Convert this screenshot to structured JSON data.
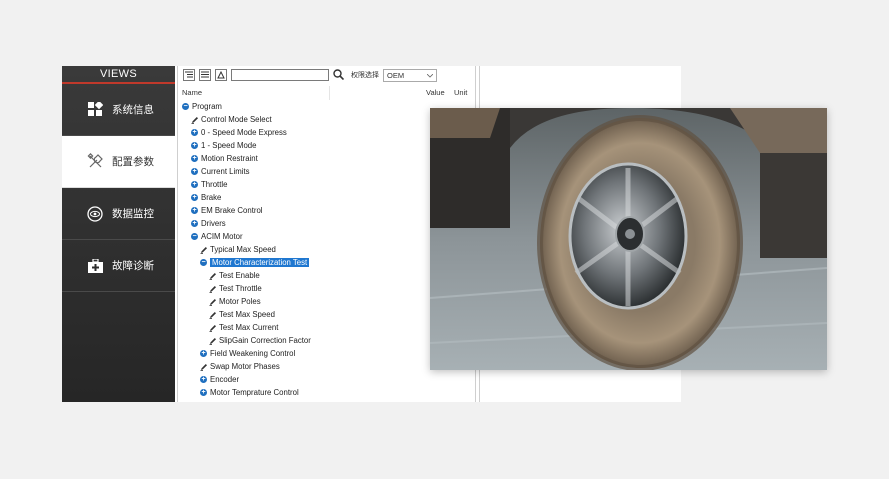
{
  "sidebar": {
    "title": "VIEWS",
    "items": [
      {
        "label": "系统信息",
        "icon": "dashboard-icon",
        "active": false
      },
      {
        "label": "配置参数",
        "icon": "tools-icon",
        "active": true
      },
      {
        "label": "数据监控",
        "icon": "eye-icon",
        "active": false
      },
      {
        "label": "故障诊断",
        "icon": "toolbox-icon",
        "active": false
      }
    ]
  },
  "toolbar": {
    "search_value": "",
    "permission_label": "权限选择",
    "permission_value": "OEM"
  },
  "columns": {
    "name": "Name",
    "value": "Value",
    "unit": "Unit"
  },
  "tree": [
    {
      "label": "Program",
      "level": 0,
      "type": "collapse"
    },
    {
      "label": "Control Mode Select",
      "level": 1,
      "type": "param"
    },
    {
      "label": "0 - Speed Mode Express",
      "level": 1,
      "type": "expand"
    },
    {
      "label": "1 - Speed Mode",
      "level": 1,
      "type": "expand"
    },
    {
      "label": "Motion Restraint",
      "level": 1,
      "type": "expand"
    },
    {
      "label": "Current Limits",
      "level": 1,
      "type": "expand"
    },
    {
      "label": "Throttle",
      "level": 1,
      "type": "expand"
    },
    {
      "label": "Brake",
      "level": 1,
      "type": "expand"
    },
    {
      "label": "EM Brake Control",
      "level": 1,
      "type": "expand"
    },
    {
      "label": "Drivers",
      "level": 1,
      "type": "expand"
    },
    {
      "label": "ACIM Motor",
      "level": 1,
      "type": "collapse"
    },
    {
      "label": "Typical Max Speed",
      "level": 2,
      "type": "param"
    },
    {
      "label": "Motor Characterization Test",
      "level": 2,
      "type": "collapse",
      "selected": true
    },
    {
      "label": "Test Enable",
      "level": 3,
      "type": "param"
    },
    {
      "label": "Test Throttle",
      "level": 3,
      "type": "param"
    },
    {
      "label": "Motor Poles",
      "level": 3,
      "type": "param"
    },
    {
      "label": "Test Max Speed",
      "level": 3,
      "type": "param"
    },
    {
      "label": "Test Max Current",
      "level": 3,
      "type": "param"
    },
    {
      "label": "SlipGain Correction Factor",
      "level": 3,
      "type": "param"
    },
    {
      "label": "Field Weakening Control",
      "level": 2,
      "type": "expand"
    },
    {
      "label": "Swap Motor Phases",
      "level": 2,
      "type": "param"
    },
    {
      "label": "Encoder",
      "level": 2,
      "type": "expand"
    },
    {
      "label": "Motor Temprature Control",
      "level": 2,
      "type": "expand"
    }
  ],
  "colors": {
    "accent": "#c0392b",
    "selection": "#1f77d0",
    "expander": "#1f6fbf"
  }
}
